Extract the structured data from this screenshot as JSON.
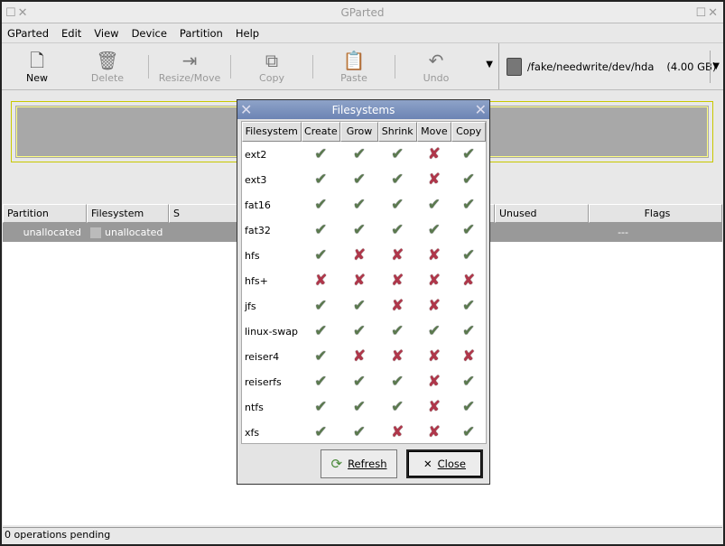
{
  "window": {
    "title": "GParted"
  },
  "menu": [
    "GParted",
    "Edit",
    "View",
    "Device",
    "Partition",
    "Help"
  ],
  "toolbar": [
    {
      "label": "New",
      "icon": "new-file-icon",
      "enabled": true,
      "glyph": "🗋"
    },
    {
      "label": "Delete",
      "icon": "trash-icon",
      "enabled": false,
      "glyph": "🗑"
    },
    {
      "label": "Resize/Move",
      "icon": "resize-move-icon",
      "enabled": false,
      "glyph": "⇥"
    },
    {
      "label": "Copy",
      "icon": "copy-icon",
      "enabled": false,
      "glyph": "⧉"
    },
    {
      "label": "Paste",
      "icon": "paste-icon",
      "enabled": false,
      "glyph": "📋"
    },
    {
      "label": "Undo",
      "icon": "undo-icon",
      "enabled": false,
      "glyph": "↶"
    }
  ],
  "device": {
    "path": "/fake/needwrite/dev/hda",
    "size": "(4.00 GB)"
  },
  "columns": [
    "Partition",
    "Filesystem",
    "S",
    "",
    "",
    "Unused",
    "Flags"
  ],
  "partitions": [
    {
      "partition": "unallocated",
      "filesystem": "unallocated",
      "unused": "---"
    }
  ],
  "status": "0 operations pending",
  "dialog": {
    "title": "Filesystems",
    "headers": [
      "Filesystem",
      "Create",
      "Grow",
      "Shrink",
      "Move",
      "Copy"
    ],
    "rows": [
      {
        "fs": "ext2",
        "s": [
          1,
          1,
          1,
          0,
          1
        ]
      },
      {
        "fs": "ext3",
        "s": [
          1,
          1,
          1,
          0,
          1
        ]
      },
      {
        "fs": "fat16",
        "s": [
          1,
          1,
          1,
          1,
          1
        ]
      },
      {
        "fs": "fat32",
        "s": [
          1,
          1,
          1,
          1,
          1
        ]
      },
      {
        "fs": "hfs",
        "s": [
          1,
          0,
          0,
          0,
          1
        ]
      },
      {
        "fs": "hfs+",
        "s": [
          0,
          0,
          0,
          0,
          0
        ]
      },
      {
        "fs": "jfs",
        "s": [
          1,
          1,
          0,
          0,
          1
        ]
      },
      {
        "fs": "linux-swap",
        "s": [
          1,
          1,
          1,
          1,
          1
        ]
      },
      {
        "fs": "reiser4",
        "s": [
          1,
          0,
          0,
          0,
          0
        ]
      },
      {
        "fs": "reiserfs",
        "s": [
          1,
          1,
          1,
          0,
          1
        ]
      },
      {
        "fs": "ntfs",
        "s": [
          1,
          1,
          1,
          0,
          1
        ]
      },
      {
        "fs": "xfs",
        "s": [
          1,
          1,
          0,
          0,
          1
        ]
      }
    ],
    "refresh_label": "Refresh",
    "close_label": "Close"
  }
}
